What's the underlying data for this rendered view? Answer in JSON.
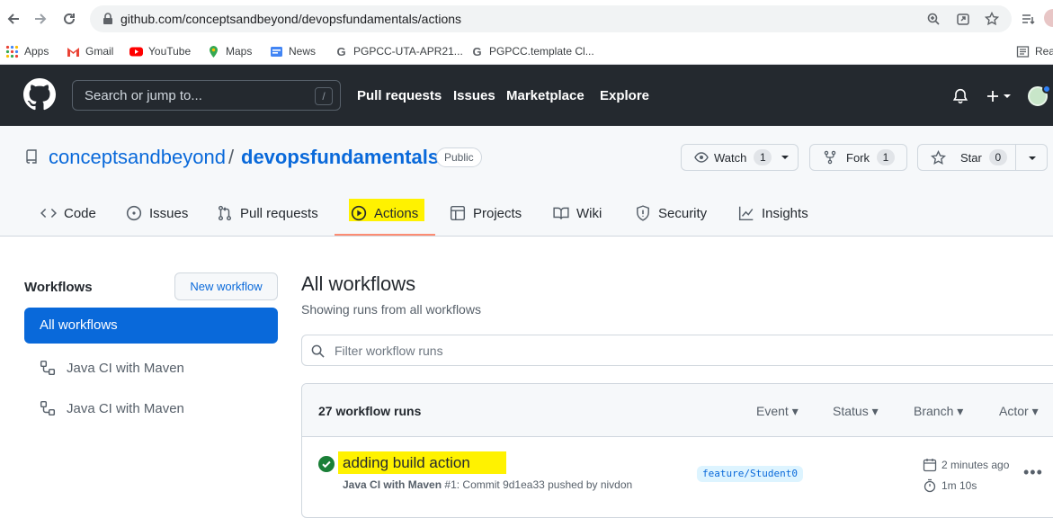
{
  "browser": {
    "url": "github.com/conceptsandbeyond/devopsfundamentals/actions",
    "bookmarks": [
      "Apps",
      "Gmail",
      "YouTube",
      "Maps",
      "News",
      "PGPCC-UTA-APR21...",
      "PGPCC.template Cl...",
      "Rea"
    ]
  },
  "header": {
    "search_placeholder": "Search or jump to...",
    "search_key": "/",
    "nav": [
      "Pull requests",
      "Issues",
      "Marketplace",
      "Explore"
    ]
  },
  "repo": {
    "owner": "conceptsandbeyond",
    "separator": "/",
    "name": "devopsfundamentals",
    "visibility": "Public",
    "watch": {
      "label": "Watch",
      "count": "1"
    },
    "fork": {
      "label": "Fork",
      "count": "1"
    },
    "star": {
      "label": "Star",
      "count": "0"
    },
    "tabs": [
      "Code",
      "Issues",
      "Pull requests",
      "Actions",
      "Projects",
      "Wiki",
      "Security",
      "Insights"
    ],
    "active_tab": "Actions"
  },
  "sidebar": {
    "title": "Workflows",
    "new_workflow": "New workflow",
    "items": [
      "All workflows",
      "Java CI with Maven",
      "Java CI with Maven"
    ]
  },
  "main": {
    "title": "All workflows",
    "subtitle": "Showing runs from all workflows",
    "filter_placeholder": "Filter workflow runs",
    "runs_count": "27 workflow runs",
    "filters": [
      "Event",
      "Status",
      "Branch",
      "Actor"
    ],
    "run": {
      "title": "adding build action",
      "workflow": "Java CI with Maven",
      "meta": "#1: Commit 9d1ea33 pushed by nivdon",
      "branch": "feature/Student0",
      "time_ago": "2 minutes ago",
      "duration": "1m 10s"
    }
  },
  "colors": {
    "accent": "#0969da",
    "success": "#1a7f37",
    "highlight": "#fff200",
    "header_bg": "#24292f"
  }
}
